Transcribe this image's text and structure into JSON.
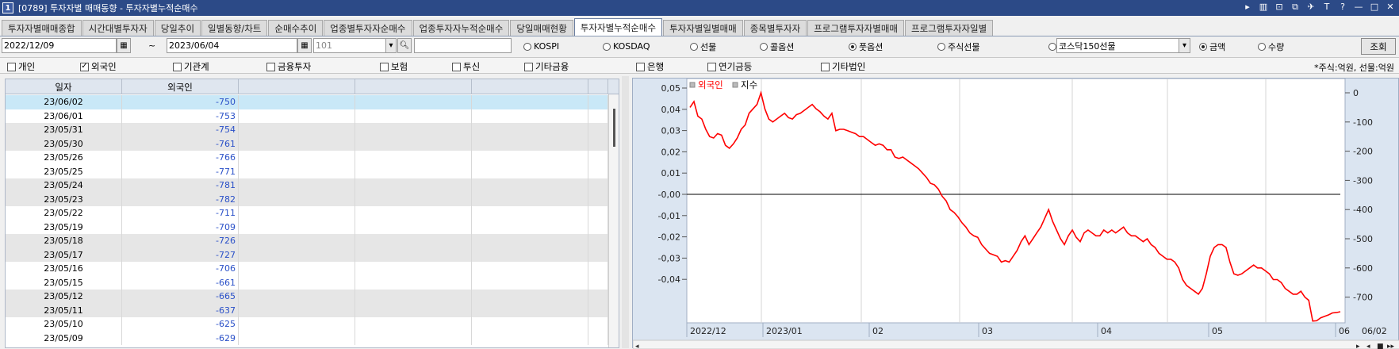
{
  "window": {
    "badge": "1",
    "title": "[0789] 투자자별 매매동향 - 투자자별누적순매수",
    "controls": [
      "▸",
      "▥",
      "⊡",
      "⧉",
      "✈",
      "T",
      "?",
      "—",
      "□",
      "✕"
    ]
  },
  "tabs": [
    {
      "label": "투자자별매매종합",
      "active": false
    },
    {
      "label": "시간대별투자자",
      "active": false
    },
    {
      "label": "당일추이",
      "active": false
    },
    {
      "label": "일별동향/차트",
      "active": false
    },
    {
      "label": "순매수추이",
      "active": false
    },
    {
      "label": "업종별투자자순매수",
      "active": false
    },
    {
      "label": "업종투자자누적순매수",
      "active": false
    },
    {
      "label": "당일매매현황",
      "active": false
    },
    {
      "label": "투자자별누적순매수",
      "active": true
    },
    {
      "label": "투자자별일별매매",
      "active": false
    },
    {
      "label": "종목별투자자",
      "active": false
    },
    {
      "label": "프로그램투자자별매매",
      "active": false
    },
    {
      "label": "프로그램투자자일별",
      "active": false
    }
  ],
  "toolbar": {
    "start_date": "2022/12/09",
    "tilde": "~",
    "end_date": "2023/06/04",
    "code": "101",
    "search_value": "",
    "markets": [
      {
        "label": "KOSPI",
        "selected": false
      },
      {
        "label": "KOSDAQ",
        "selected": false
      },
      {
        "label": "선물",
        "selected": false
      },
      {
        "label": "콜옵션",
        "selected": false
      },
      {
        "label": "풋옵션",
        "selected": true
      },
      {
        "label": "주식선물",
        "selected": false
      },
      {
        "label": "",
        "selected": false
      }
    ],
    "product_select": "코스닥150선물",
    "measures": [
      {
        "label": "금액",
        "selected": true
      },
      {
        "label": "수량",
        "selected": false
      }
    ],
    "query_label": "조회"
  },
  "investors": [
    {
      "label": "개인",
      "checked": false
    },
    {
      "label": "외국인",
      "checked": true
    },
    {
      "label": "기관계",
      "checked": false
    },
    {
      "label": "금융투자",
      "checked": false
    },
    {
      "label": "보험",
      "checked": false
    },
    {
      "label": "투신",
      "checked": false
    },
    {
      "label": "기타금융",
      "checked": false
    },
    {
      "label": "은행",
      "checked": false
    },
    {
      "label": "연기금등",
      "checked": false
    },
    {
      "label": "기타법인",
      "checked": false
    }
  ],
  "unit_note": "*주식:억원, 선물:억원",
  "grid": {
    "headers": [
      "일자",
      "외국인",
      "",
      "",
      "",
      ""
    ],
    "rows": [
      {
        "date": "23/06/02",
        "value": "-750"
      },
      {
        "date": "23/06/01",
        "value": "-753"
      },
      {
        "date": "23/05/31",
        "value": "-754"
      },
      {
        "date": "23/05/30",
        "value": "-761"
      },
      {
        "date": "23/05/26",
        "value": "-766"
      },
      {
        "date": "23/05/25",
        "value": "-771"
      },
      {
        "date": "23/05/24",
        "value": "-781"
      },
      {
        "date": "23/05/23",
        "value": "-782"
      },
      {
        "date": "23/05/22",
        "value": "-711"
      },
      {
        "date": "23/05/19",
        "value": "-709"
      },
      {
        "date": "23/05/18",
        "value": "-726"
      },
      {
        "date": "23/05/17",
        "value": "-727"
      },
      {
        "date": "23/05/16",
        "value": "-706"
      },
      {
        "date": "23/05/15",
        "value": "-661"
      },
      {
        "date": "23/05/12",
        "value": "-665"
      },
      {
        "date": "23/05/11",
        "value": "-637"
      },
      {
        "date": "23/05/10",
        "value": "-625"
      },
      {
        "date": "23/05/09",
        "value": "-629"
      }
    ]
  },
  "chart_data": {
    "type": "line",
    "legend": [
      {
        "name": "외국인",
        "color": "#ff0000"
      },
      {
        "name": "지수",
        "color": "#000000"
      }
    ],
    "legend_position": "top-left",
    "left_axis": {
      "ticks": [
        "0,05",
        "0,04",
        "0,03",
        "0,02",
        "0,01",
        "-0,00",
        "-0,01",
        "-0,02",
        "-0,03",
        "-0,04"
      ],
      "range": [
        -0.05,
        0.05
      ]
    },
    "right_axis": {
      "ticks": [
        "0",
        "-100",
        "-200",
        "-300",
        "-400",
        "-500",
        "-600",
        "-700"
      ],
      "range": [
        -780,
        30
      ]
    },
    "x_labels": [
      "2022/12",
      "2023/01",
      "02",
      "03",
      "04",
      "05",
      "06"
    ],
    "x_axis_end_label": "06/02",
    "grid": true,
    "series": [
      {
        "name": "외국인",
        "color": "#ff0000",
        "axis": "right",
        "values": [
          -50,
          -30,
          -80,
          -90,
          -125,
          -150,
          -155,
          -140,
          -145,
          -180,
          -190,
          -175,
          -155,
          -125,
          -110,
          -70,
          -55,
          -40,
          0,
          -55,
          -90,
          -100,
          -90,
          -80,
          -70,
          -85,
          -90,
          -75,
          -70,
          -60,
          -50,
          -40,
          -55,
          -65,
          -80,
          -90,
          -70,
          -130,
          -125,
          -125,
          -130,
          -135,
          -140,
          -150,
          -150,
          -160,
          -170,
          -180,
          -175,
          -180,
          -195,
          -195,
          -220,
          -225,
          -220,
          -230,
          -240,
          -250,
          -260,
          -275,
          -290,
          -310,
          -315,
          -330,
          -355,
          -370,
          -400,
          -410,
          -425,
          -445,
          -460,
          -480,
          -490,
          -495,
          -520,
          -535,
          -550,
          -555,
          -560,
          -580,
          -575,
          -580,
          -560,
          -540,
          -510,
          -490,
          -520,
          -500,
          -480,
          -460,
          -430,
          -400,
          -440,
          -470,
          -500,
          -520,
          -490,
          -470,
          -495,
          -510,
          -480,
          -470,
          -480,
          -490,
          -490,
          -470,
          -480,
          -470,
          -480,
          -470,
          -460,
          -480,
          -490,
          -490,
          -500,
          -510,
          -500,
          -520,
          -530,
          -550,
          -560,
          -570,
          -570,
          -580,
          -600,
          -640,
          -660,
          -670,
          -680,
          -690,
          -670,
          -620,
          -560,
          -530,
          -520,
          -520,
          -530,
          -580,
          -620,
          -625,
          -620,
          -610,
          -600,
          -590,
          -600,
          -600,
          -610,
          -620,
          -640,
          -640,
          -650,
          -670,
          -680,
          -690,
          -690,
          -680,
          -700,
          -711,
          -782,
          -781,
          -771,
          -766,
          -761,
          -754,
          -753,
          -750
        ]
      },
      {
        "name": "지수",
        "color": "#000000",
        "axis": "left",
        "values": [
          0,
          0
        ]
      }
    ]
  }
}
